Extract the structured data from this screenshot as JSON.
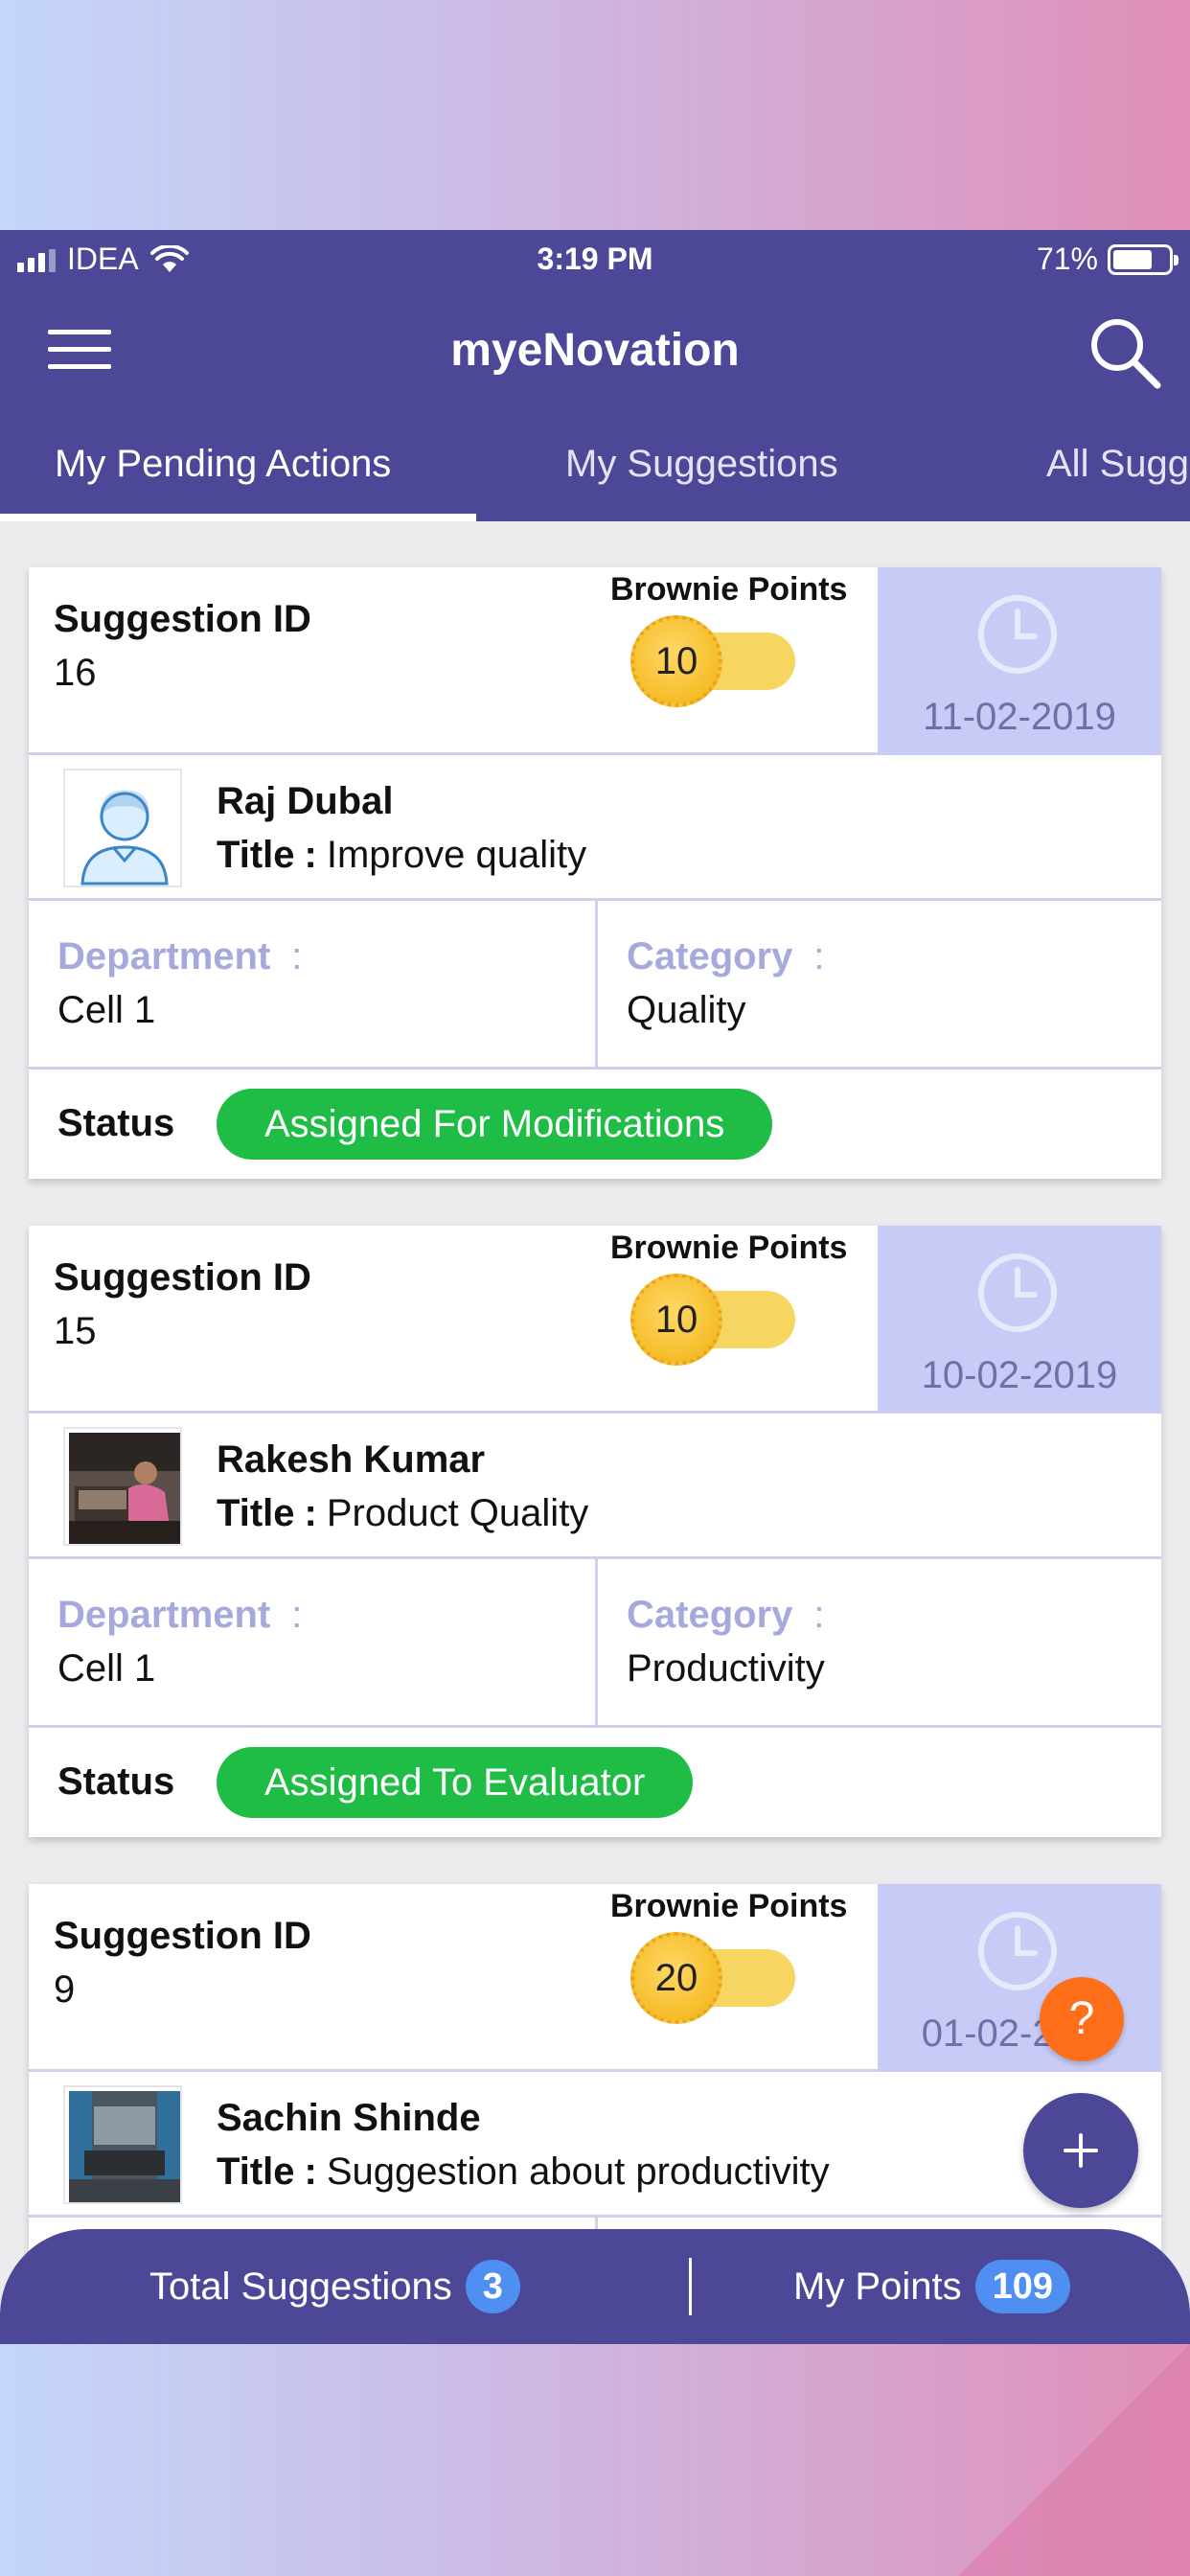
{
  "status_bar": {
    "carrier": "IDEA",
    "time": "3:19 PM",
    "battery": "71%"
  },
  "app": {
    "title": "myeNovation"
  },
  "tabs": [
    {
      "label": "My Pending Actions",
      "active": true
    },
    {
      "label": "My Suggestions",
      "active": false
    },
    {
      "label": "All Sugg",
      "active": false
    }
  ],
  "labels": {
    "suggestion_id": "Suggestion ID",
    "brownie_points": "Brownie Points",
    "title": "Title",
    "title_colon": ":",
    "department": "Department",
    "category": "Category",
    "colon": ":",
    "status": "Status"
  },
  "cards": [
    {
      "id": "16",
      "points": "10",
      "date": "11-02-2019",
      "name": "Raj Dubal",
      "title": "Improve quality",
      "department": "Cell 1",
      "category": "Quality",
      "status": "Assigned For Modifications",
      "avatar": "default-user-icon"
    },
    {
      "id": "15",
      "points": "10",
      "date": "10-02-2019",
      "name": "Rakesh Kumar",
      "title": "Product Quality",
      "department": "Cell 1",
      "category": "Productivity",
      "status": "Assigned To Evaluator",
      "avatar": "user-photo"
    },
    {
      "id": "9",
      "points": "20",
      "date": "01-02-2019",
      "name": "Sachin Shinde",
      "title": "Suggestion about productivity",
      "avatar": "user-photo"
    }
  ],
  "fab": {
    "help": "?"
  },
  "bottom_bar": {
    "total_label": "Total Suggestions",
    "total_value": "3",
    "points_label": "My Points",
    "points_value": "109"
  },
  "colors": {
    "primary": "#4c4897",
    "date_box": "#c7cbf6",
    "status_green": "#1fbd46",
    "help_orange": "#ff6f1a",
    "badge_blue": "#4f8ff1"
  }
}
